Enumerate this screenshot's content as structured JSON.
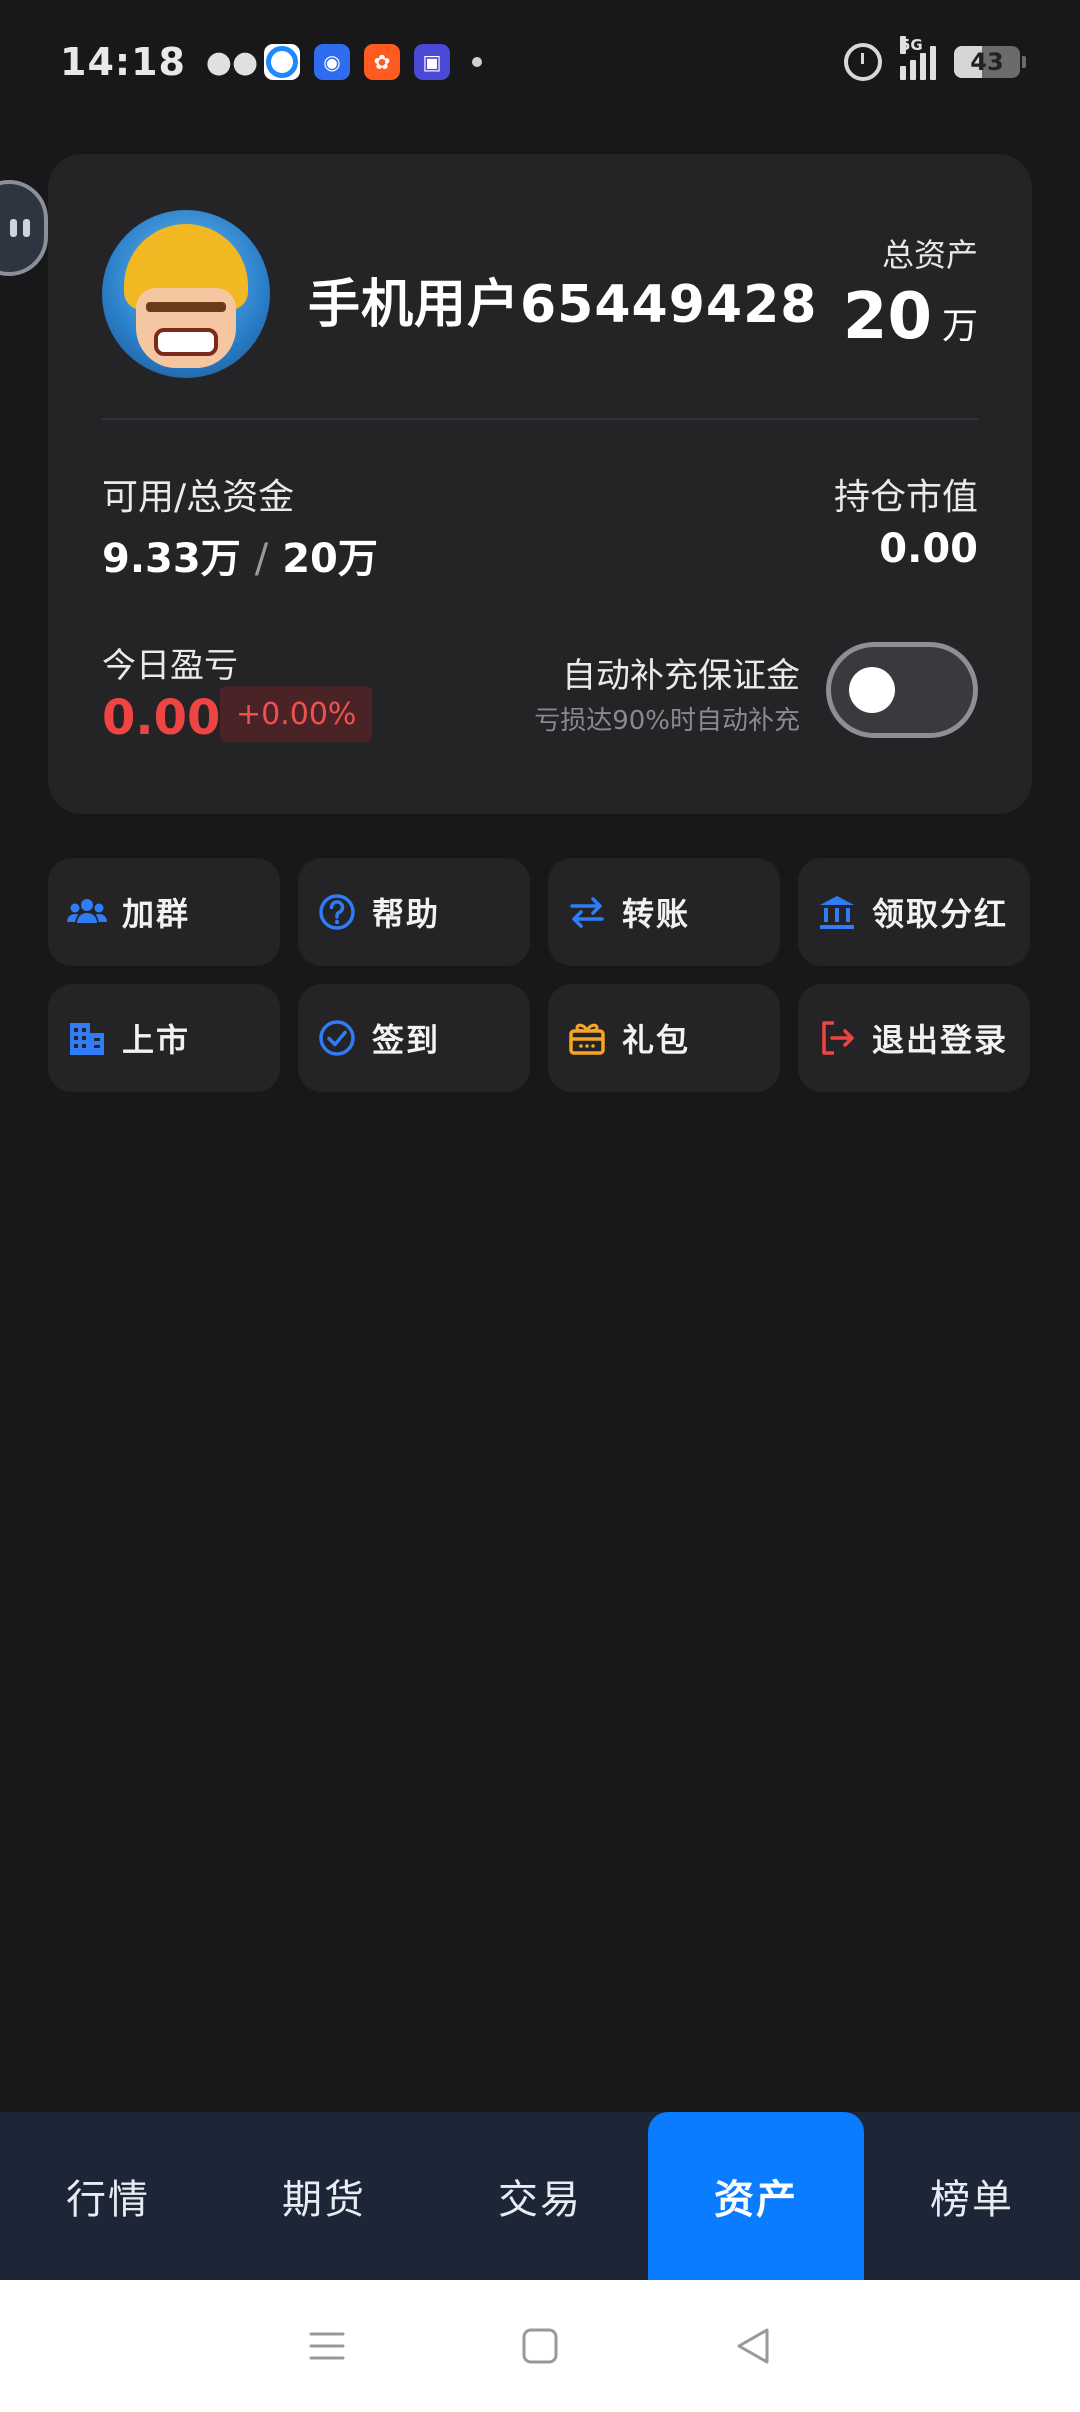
{
  "status_bar": {
    "time": "14:18",
    "network": "5G",
    "battery": "43",
    "battery_level": 0.43
  },
  "account": {
    "username": "手机用户65449428",
    "total_assets_label": "总资产",
    "total_assets_value": "20",
    "total_assets_unit": "万",
    "available_total_label": "可用/总资金",
    "available_value": "9.33万",
    "available_separator": "/",
    "total_funds_value": "20万",
    "position_value_label": "持仓市值",
    "position_value": "0.00",
    "today_pnl_label": "今日盈亏",
    "today_pnl_value": "0.00",
    "today_pnl_percent": "+0.00%",
    "auto_margin_title": "自动补充保证金",
    "auto_margin_subtitle": "亏损达90%时自动补充",
    "auto_margin_enabled": false
  },
  "shortcuts": [
    {
      "label": "加群",
      "icon": "group-icon",
      "color": "#2f7cf6"
    },
    {
      "label": "帮助",
      "icon": "help-circle-icon",
      "color": "#2f7cf6"
    },
    {
      "label": "转账",
      "icon": "transfer-icon",
      "color": "#2f7cf6"
    },
    {
      "label": "领取分红",
      "icon": "bank-icon",
      "color": "#2f7cf6"
    },
    {
      "label": "上市",
      "icon": "building-icon",
      "color": "#2f7cf6"
    },
    {
      "label": "签到",
      "icon": "check-circle-icon",
      "color": "#2f7cf6"
    },
    {
      "label": "礼包",
      "icon": "gift-icon",
      "color": "#f5a623"
    },
    {
      "label": "退出登录",
      "icon": "logout-icon",
      "color": "#ef4444"
    }
  ],
  "tabs": [
    {
      "label": "行情",
      "active": false
    },
    {
      "label": "期货",
      "active": false
    },
    {
      "label": "交易",
      "active": false
    },
    {
      "label": "资产",
      "active": true
    },
    {
      "label": "榜单",
      "active": false
    }
  ],
  "colors": {
    "accent": "#0a7cff",
    "loss_red": "#ef4444",
    "background": "#18181b",
    "card": "#242427"
  }
}
